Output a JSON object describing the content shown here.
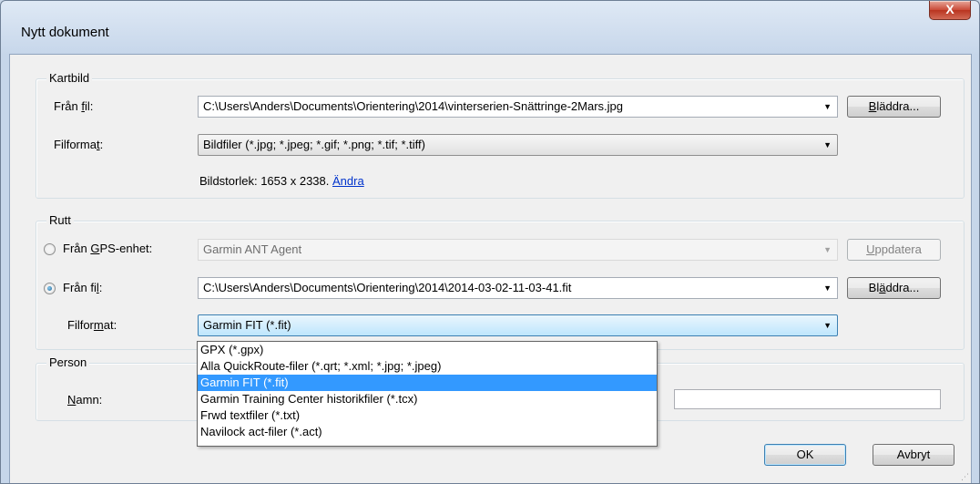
{
  "window": {
    "title": "Nytt dokument",
    "close_label": "X"
  },
  "kartbild": {
    "legend": "Kartbild",
    "from_file_label_pre": "Från ",
    "from_file_label_u": "f",
    "from_file_label_post": "il:",
    "from_file_value": "C:\\Users\\Anders\\Documents\\Orientering\\2014\\vinterserien-Snättringe-2Mars.jpg",
    "browse_u": "B",
    "browse_post": "läddra...",
    "format_label_pre": "Filforma",
    "format_label_u": "t",
    "format_label_post": ":",
    "format_value": "Bildfiler  (*.jpg; *.jpeg; *.gif; *.png; *.tif; *.tiff)",
    "size_text": "Bildstorlek: 1653 x 2338.",
    "change_link": "Ändra"
  },
  "rutt": {
    "legend": "Rutt",
    "gps_label_pre": "Från ",
    "gps_label_u": "G",
    "gps_label_post": "PS-enhet:",
    "gps_value": "Garmin ANT Agent",
    "update_u": "U",
    "update_post": "ppdatera",
    "from_file_label_pre": "Från fi",
    "from_file_label_u": "l",
    "from_file_label_post": ":",
    "from_file_value": "C:\\Users\\Anders\\Documents\\Orientering\\2014\\2014-03-02-11-03-41.fit",
    "browse_pre": "Bl",
    "browse_u": "ä",
    "browse_post": "ddra...",
    "format_label_pre": "Filfor",
    "format_label_u": "m",
    "format_label_post": "at:",
    "format_value": "Garmin FIT (*.fit)",
    "options": [
      "GPX (*.gpx)",
      "Alla QuickRoute-filer (*.qrt; *.xml; *.jpg; *.jpeg)",
      "Garmin FIT (*.fit)",
      "Garmin Training Center historikfiler (*.tcx)",
      "Frwd textfiler (*.txt)",
      "Navilock act-filer (*.act)"
    ],
    "selected_option": "Garmin FIT (*.fit)"
  },
  "person": {
    "legend": "Person",
    "name_label_u": "N",
    "name_label_post": "amn:"
  },
  "footer": {
    "ok_label": "OK",
    "cancel_label": "Avbryt"
  },
  "icons": {
    "dropdown_arrow": "▼",
    "resize_grip": "⋰"
  }
}
